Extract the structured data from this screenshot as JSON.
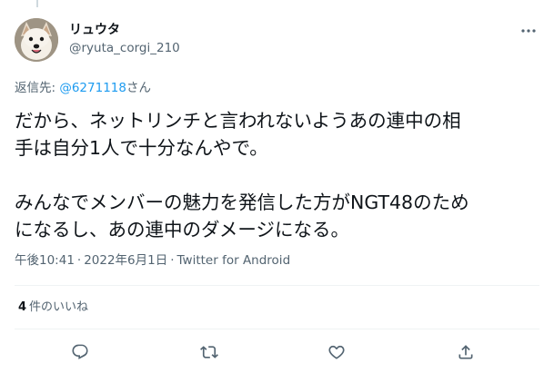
{
  "tweet": {
    "author": {
      "display_name": "リュウタ",
      "handle": "@ryuta_corgi_210",
      "avatar_icon": "corgi-avatar"
    },
    "replying_to": {
      "prefix": "返信先: ",
      "mention": "@6271118",
      "suffix": "さん"
    },
    "text_lines": [
      "だから、ネットリンチと言われないようあの連中の相",
      "手は自分1人で十分なんやで。",
      "みんなでメンバーの魅力を発信した方がNGT48のため",
      "になるし、あの連中のダメージになる。"
    ],
    "time": "午後10:41",
    "date": "2022年6月1日",
    "separator": "·",
    "source": "Twitter for Android",
    "likes": {
      "count": "4",
      "label": "件のいいね"
    },
    "actions": [
      "reply-icon",
      "retweet-icon",
      "like-icon",
      "share-icon"
    ],
    "colors": {
      "accent": "#1d9bf0",
      "text": "#0f1419",
      "secondary": "#536471",
      "divider": "#eff3f4"
    }
  }
}
